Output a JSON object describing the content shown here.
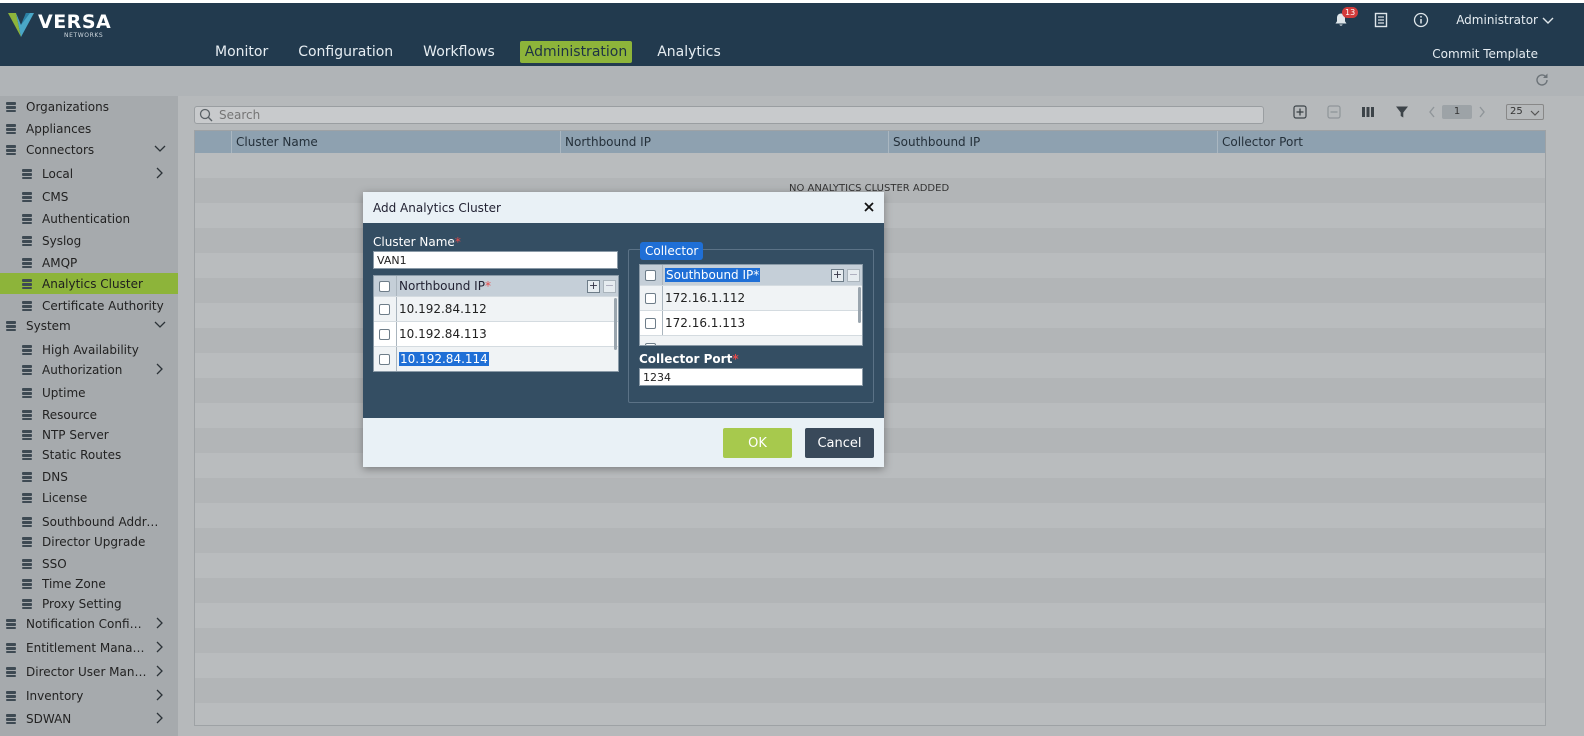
{
  "header": {
    "brand": "VERSA",
    "brand_sub": "NETWORKS",
    "nav": [
      {
        "label": "Monitor"
      },
      {
        "label": "Configuration"
      },
      {
        "label": "Workflows"
      },
      {
        "label": "Administration",
        "active": true
      },
      {
        "label": "Analytics"
      }
    ],
    "notification_count": "13",
    "user": "Administrator",
    "commit_label": "Commit Template",
    "icons": [
      "bell-icon",
      "clipboard-icon",
      "info-icon",
      "chevron-down-icon",
      "refresh-icon"
    ]
  },
  "sidebar": {
    "items": [
      {
        "label": "Organizations",
        "icon": "org-icon"
      },
      {
        "label": "Appliances",
        "icon": "stack-icon"
      },
      {
        "label": "Connectors",
        "icon": "plug-icon",
        "expanded": true
      },
      {
        "label": "Local",
        "icon": "local-icon"
      },
      {
        "label": "CMS",
        "icon": "cms-icon"
      },
      {
        "label": "Authentication",
        "icon": "auth-icon"
      },
      {
        "label": "Syslog",
        "icon": "syslog-icon"
      },
      {
        "label": "AMQP",
        "icon": "amqp-icon"
      },
      {
        "label": "Analytics Cluster",
        "icon": "cluster-icon",
        "active": true
      },
      {
        "label": "Certificate Authority",
        "icon": "cert-icon"
      },
      {
        "label": "System",
        "icon": "system-icon",
        "expanded": true
      },
      {
        "label": "High Availability",
        "icon": "ha-icon"
      },
      {
        "label": "Authorization",
        "icon": "authz-icon"
      },
      {
        "label": "Uptime",
        "icon": "uptime-icon"
      },
      {
        "label": "Resource",
        "icon": "resource-icon"
      },
      {
        "label": "NTP Server",
        "icon": "ntp-icon"
      },
      {
        "label": "Static Routes",
        "icon": "routes-icon"
      },
      {
        "label": "DNS",
        "icon": "dns-icon"
      },
      {
        "label": "License",
        "icon": "license-icon"
      },
      {
        "label": "Southbound Addres...",
        "icon": "southbound-icon"
      },
      {
        "label": "Director Upgrade",
        "icon": "upgrade-icon"
      },
      {
        "label": "SSO",
        "icon": "sso-icon"
      },
      {
        "label": "Time Zone",
        "icon": "timezone-icon"
      },
      {
        "label": "Proxy Setting",
        "icon": "proxy-icon"
      },
      {
        "label": "Notification Config...",
        "icon": "notification-icon"
      },
      {
        "label": "Entitlement Manager",
        "icon": "gear-icon"
      },
      {
        "label": "Director User Mana...",
        "icon": "users-icon"
      },
      {
        "label": "Inventory",
        "icon": "inventory-icon"
      },
      {
        "label": "SDWAN",
        "icon": "sdwan-icon"
      }
    ]
  },
  "main": {
    "search_placeholder": "Search",
    "page_number": "1",
    "per_page": "25",
    "columns": [
      "Cluster Name",
      "Northbound IP",
      "Southbound IP",
      "Collector Port"
    ],
    "empty_message": "NO ANALYTICS CLUSTER ADDED"
  },
  "modal": {
    "title": "Add Analytics Cluster",
    "cluster_name_label": "Cluster Name",
    "cluster_name_value": "VAN1",
    "northbound_header": "Northbound IP",
    "northbound_rows": [
      "10.192.84.112",
      "10.192.84.113",
      "10.192.84.114"
    ],
    "collector_legend": "Collector",
    "southbound_header": "Southbound IP",
    "southbound_rows": [
      "172.16.1.112",
      "172.16.1.113"
    ],
    "collector_port_label": "Collector Port",
    "collector_port_value": "1234",
    "required_mark": "*",
    "ok_label": "OK",
    "cancel_label": "Cancel"
  },
  "colors": {
    "topbar": "#223a4e",
    "accent": "#8db43a",
    "modal_body": "#344e63",
    "selection": "#1f6fd6",
    "ok_button": "#a7c94d",
    "cancel_button": "#39495a"
  }
}
